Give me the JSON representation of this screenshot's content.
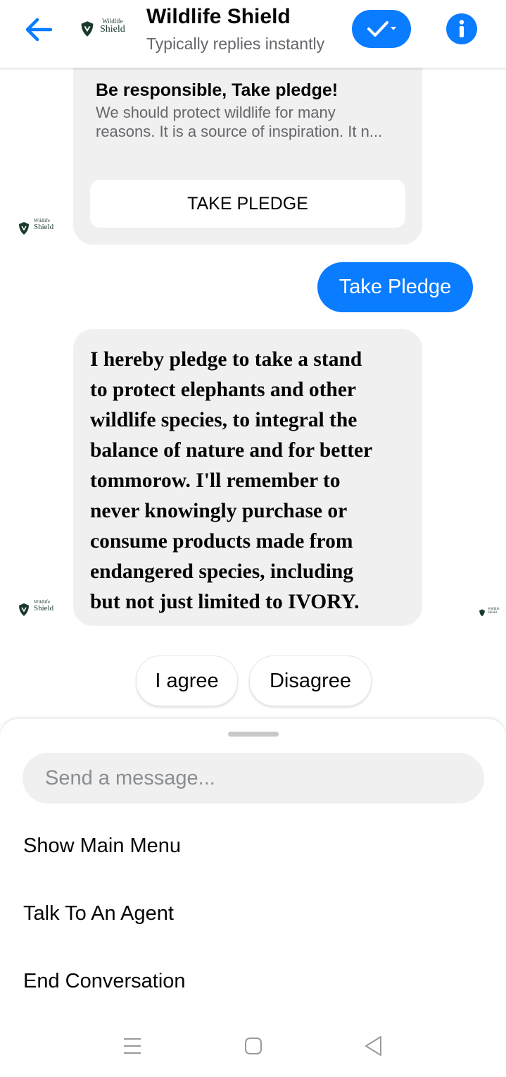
{
  "header": {
    "title": "Wildlife Shield",
    "subtitle": "Typically replies instantly",
    "logo_top": "Wildlife",
    "logo_bottom": "Shield"
  },
  "card": {
    "title": "Be responsible, Take pledge!",
    "description": "We should protect wildlife for many reasons. It is a source of inspiration. It n...",
    "button_label": "TAKE PLEDGE"
  },
  "outgoing_message": "Take Pledge",
  "pledge_message": "I hereby pledge to take a stand\nto protect elephants and other\nwildlife species, to integral the\nbalance of nature and for better\ntommorow. I'll remember to\nnever knowingly purchase or\nconsume products made from\nendangered species, including\nbut not just limited to IVORY.",
  "quick_replies": [
    "I agree",
    "Disagree"
  ],
  "composer": {
    "placeholder": "Send a message..."
  },
  "menu": [
    "Show Main Menu",
    "Talk To An Agent",
    "End Conversation"
  ],
  "colors": {
    "accent": "#0a7cff",
    "bubble_gray": "#f0f0f0",
    "logo_green": "#1a3a2c"
  },
  "icons": {
    "back": "arrow-left-icon",
    "verify": "check-icon",
    "info": "info-icon",
    "nav": [
      "menu-icon",
      "home-icon",
      "back-triangle-icon"
    ]
  }
}
